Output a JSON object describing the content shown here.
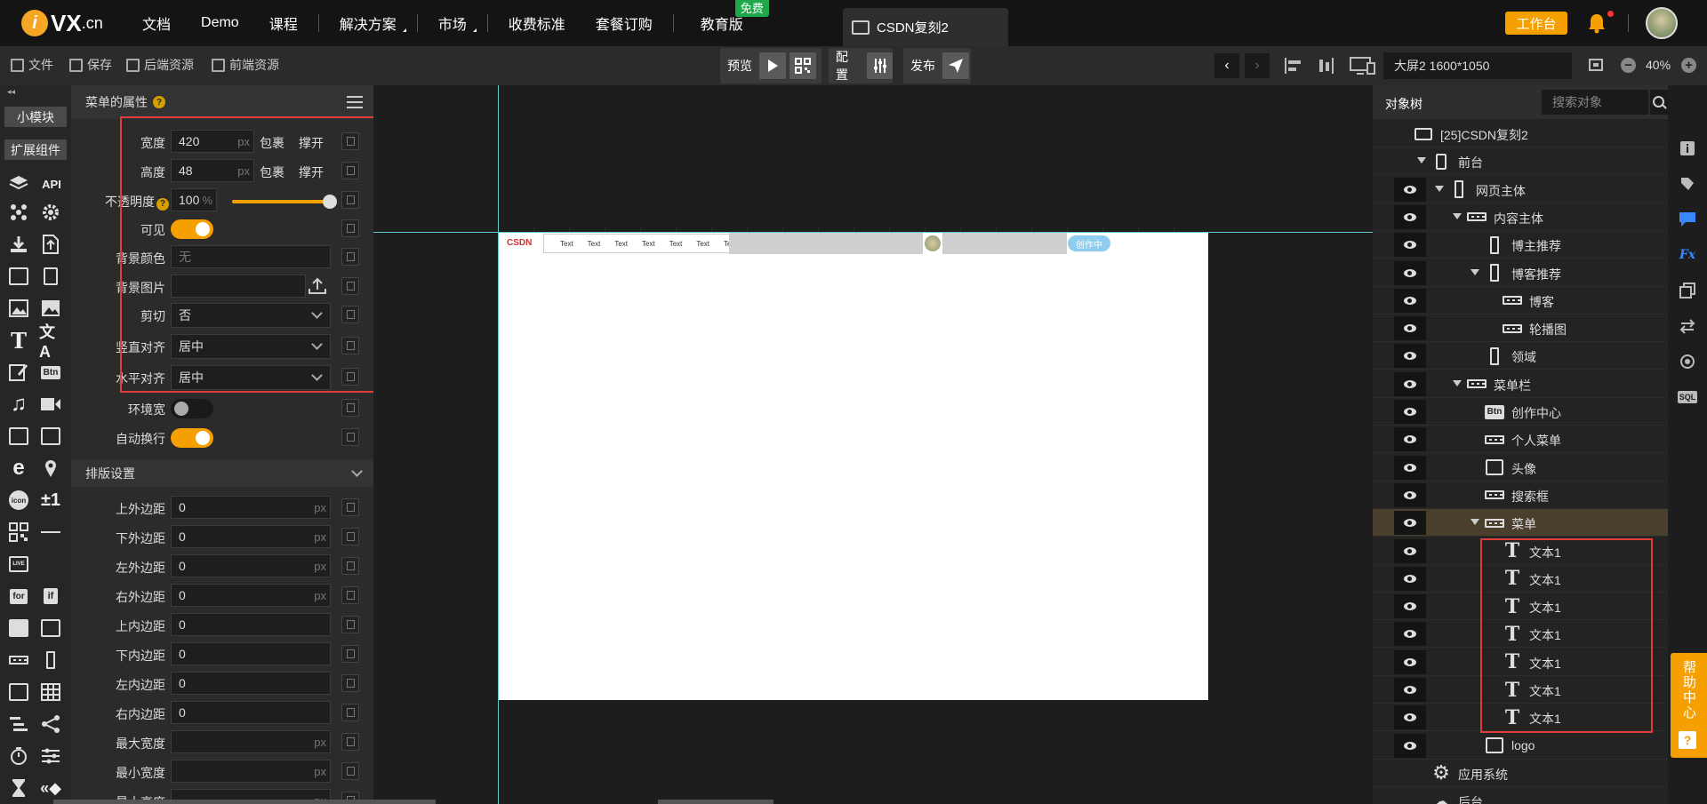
{
  "topnav": {
    "logo_text": "VX",
    "logo_cn": ".cn",
    "items": [
      {
        "label": "文档"
      },
      {
        "label": "Demo"
      },
      {
        "label": "课程"
      },
      {
        "label": "解决方案"
      },
      {
        "label": "市场"
      },
      {
        "label": "收费标准"
      },
      {
        "label": "套餐订购"
      },
      {
        "label": "教育版"
      }
    ],
    "free_badge": "免费",
    "app_tab": "CSDN复刻2",
    "workbench": "工作台"
  },
  "toolbar": {
    "file": "文件",
    "save": "保存",
    "backend": "后端资源",
    "frontend": "前端资源",
    "preview": "预览",
    "config": "配置",
    "publish": "发布",
    "screen": "大屏2 1600*1050",
    "zoom": "40%"
  },
  "leftstrip": {
    "small_module": "小模块",
    "ext_component": "扩展组件",
    "api": "API",
    "btn": "Btn",
    "for": "for",
    "if": "if",
    "icon": "icon",
    "live": "LIVE"
  },
  "props": {
    "title": "菜单的属性",
    "rows": {
      "width": {
        "label": "宽度",
        "value": "420",
        "unit": "px",
        "wrap": "包裹",
        "expand": "撑开"
      },
      "height": {
        "label": "高度",
        "value": "48",
        "unit": "px",
        "wrap": "包裹",
        "expand": "撑开"
      },
      "opacity": {
        "label": "不透明度",
        "value": "100",
        "unit": "%",
        "level": 1.0
      },
      "visible": {
        "label": "可见"
      },
      "bgcolor": {
        "label": "背景颜色",
        "placeholder": "无"
      },
      "bgimage": {
        "label": "背景图片"
      },
      "clip": {
        "label": "剪切",
        "value": "否"
      },
      "valign": {
        "label": "竖直对齐",
        "value": "居中"
      },
      "halign": {
        "label": "水平对齐",
        "value": "居中"
      },
      "envwidth": {
        "label": "环境宽"
      },
      "autowrap": {
        "label": "自动换行"
      }
    },
    "layout_section": "排版设置",
    "layout_rows": [
      {
        "label": "上外边距",
        "value": "0",
        "unit": "px"
      },
      {
        "label": "下外边距",
        "value": "0",
        "unit": "px"
      },
      {
        "label": "左外边距",
        "value": "0",
        "unit": "px"
      },
      {
        "label": "右外边距",
        "value": "0",
        "unit": "px"
      },
      {
        "label": "上内边距",
        "value": "0",
        "unit": ""
      },
      {
        "label": "下内边距",
        "value": "0",
        "unit": ""
      },
      {
        "label": "左内边距",
        "value": "0",
        "unit": ""
      },
      {
        "label": "右内边距",
        "value": "0",
        "unit": ""
      },
      {
        "label": "最大宽度",
        "value": "",
        "unit": "px"
      },
      {
        "label": "最小宽度",
        "value": "",
        "unit": "px"
      },
      {
        "label": "最大高度",
        "value": "",
        "unit": "px"
      }
    ]
  },
  "canvas": {
    "logo": "CSDN",
    "menu_items": [
      "Text",
      "Text",
      "Text",
      "Text",
      "Text",
      "Text",
      "Text"
    ],
    "create_btn": "创作中"
  },
  "tree": {
    "title": "对象树",
    "search_placeholder": "搜索对象",
    "items": [
      {
        "label": "[25]CSDN复刻2",
        "icon": "app-icon",
        "eye": false
      },
      {
        "label": "前台",
        "icon": "phone-icon",
        "eye": false,
        "arrow": true
      },
      {
        "label": "网页主体",
        "icon": "vertical-container-icon",
        "eye": true,
        "arrow": true
      },
      {
        "label": "内容主体",
        "icon": "horizontal-container-icon",
        "eye": true,
        "arrow": true
      },
      {
        "label": "博主推荐",
        "icon": "vertical-container-icon",
        "eye": true
      },
      {
        "label": "博客推荐",
        "icon": "vertical-container-icon",
        "eye": true,
        "arrow": true
      },
      {
        "label": "博客",
        "icon": "horizontal-container-icon",
        "eye": true
      },
      {
        "label": "轮播图",
        "icon": "horizontal-container-icon",
        "eye": true
      },
      {
        "label": "领域",
        "icon": "vertical-container-icon",
        "eye": true
      },
      {
        "label": "菜单栏",
        "icon": "horizontal-container-icon",
        "eye": true,
        "arrow": true
      },
      {
        "label": "创作中心",
        "icon": "button-icon",
        "eye": true
      },
      {
        "label": "个人菜单",
        "icon": "horizontal-container-icon",
        "eye": true
      },
      {
        "label": "头像",
        "icon": "image-icon",
        "eye": true
      },
      {
        "label": "搜索框",
        "icon": "horizontal-container-icon",
        "eye": true
      },
      {
        "label": "菜单",
        "icon": "horizontal-container-icon",
        "eye": true,
        "arrow": true,
        "selected": true
      },
      {
        "label": "文本1",
        "icon": "text-icon",
        "eye": true
      },
      {
        "label": "文本1",
        "icon": "text-icon",
        "eye": true
      },
      {
        "label": "文本1",
        "icon": "text-icon",
        "eye": true
      },
      {
        "label": "文本1",
        "icon": "text-icon",
        "eye": true
      },
      {
        "label": "文本1",
        "icon": "text-icon",
        "eye": true
      },
      {
        "label": "文本1",
        "icon": "text-icon",
        "eye": true
      },
      {
        "label": "文本1",
        "icon": "text-icon",
        "eye": true
      },
      {
        "label": "logo",
        "icon": "image-icon",
        "eye": true
      },
      {
        "label": "应用系统",
        "icon": "gear-icon",
        "eye": false
      },
      {
        "label": "后台",
        "icon": "cloud-icon",
        "eye": false
      }
    ]
  },
  "help": {
    "label": "帮助中心",
    "q": "?"
  },
  "colors": {
    "accent": "#f5a000",
    "selection_border": "#e03c3c",
    "guide": "#5fc8c8"
  }
}
